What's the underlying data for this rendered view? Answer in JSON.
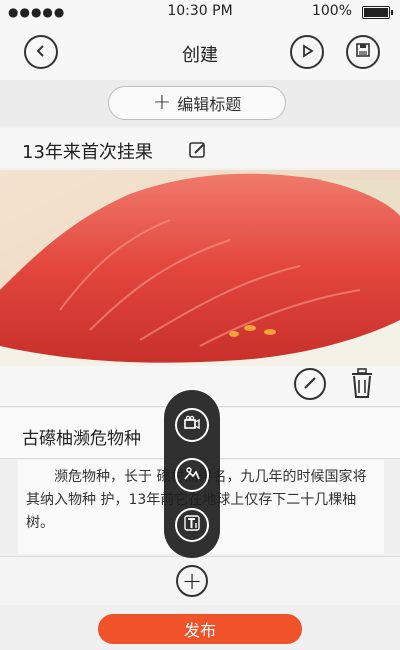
{
  "status_bar": {
    "signal": "●●●●●",
    "time": "10:30 PM",
    "battery": "100%"
  },
  "nav": {
    "title": "创建",
    "back_icon": "back-arrow-icon",
    "play_icon": "play-icon",
    "save_icon": "save-icon"
  },
  "add_title": {
    "label": "编辑标题"
  },
  "post": {
    "title": "13年来首次挂果",
    "subtitle": "古礤柚濒危物种",
    "body": "濒危物种，长于 礤村而得名，九几年的时候国家将其纳入物种 护，13年前它在地球上仅存下二十几棵柚树。"
  },
  "floating_menu": {
    "items": [
      "video-icon",
      "image-icon",
      "text-icon"
    ]
  },
  "publish": {
    "label": "发布"
  },
  "colors": {
    "accent": "#f0522a",
    "menu_bg": "#1e1e1e"
  }
}
